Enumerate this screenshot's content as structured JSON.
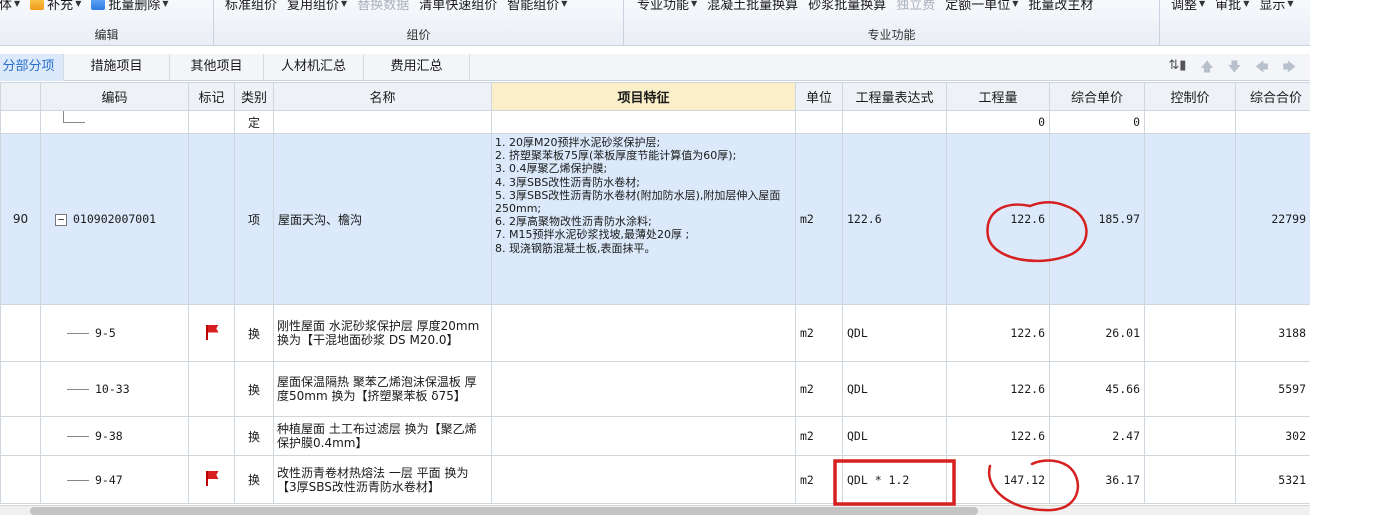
{
  "ribbon": {
    "groups": [
      {
        "label": "编辑",
        "items": [
          {
            "text": "体",
            "caret": true
          },
          {
            "text": "补充",
            "caret": true,
            "icon": "yellow"
          },
          {
            "text": "批量删除",
            "caret": true,
            "icon": "blue"
          }
        ]
      },
      {
        "label": "组价",
        "items": [
          {
            "text": "标准组价"
          },
          {
            "text": "复用组价",
            "caret": true
          },
          {
            "text": "替换数据",
            "disabled": true
          },
          {
            "text": "清单快速组价"
          },
          {
            "text": "智能组价",
            "caret": true
          }
        ]
      },
      {
        "label": "专业功能",
        "items": [
          {
            "text": "专业功能",
            "caret": true
          },
          {
            "text": "混凝土批量换算"
          },
          {
            "text": "砂浆批量换算"
          },
          {
            "text": "独立费",
            "disabled": true
          },
          {
            "text": "定额一单位",
            "caret": true
          },
          {
            "text": "批量改主材"
          }
        ]
      },
      {
        "label": "",
        "items": [
          {
            "text": "调整",
            "caret": true
          },
          {
            "text": "审批",
            "caret": true
          },
          {
            "text": "显示",
            "caret": true
          }
        ]
      }
    ]
  },
  "tabs": [
    "分部分项",
    "措施项目",
    "其他项目",
    "人材机汇总",
    "费用汇总"
  ],
  "tab_tools": [
    "⇅▮",
    "🡅",
    "🡇",
    "🡄",
    "🡆"
  ],
  "columns": [
    "",
    "编码",
    "标记",
    "类别",
    "名称",
    "项目特征",
    "单位",
    "工程量表达式",
    "工程量",
    "综合单价",
    "控制价",
    "综合合价"
  ],
  "rows": [
    {
      "no": "",
      "code": "",
      "mark": false,
      "type": "定",
      "name": "",
      "feature": [],
      "unit": "",
      "expr": "",
      "qty": "0",
      "price": "0",
      "ctrl": "",
      "total": ""
    },
    {
      "no": "90",
      "code": "010902007001",
      "mark": false,
      "type": "项",
      "name": "屋面天沟、檐沟",
      "feature": [
        "1. 20厚M20预拌水泥砂浆保护层;",
        "2. 挤塑聚苯板75厚(苯板厚度节能计算值为60厚);",
        "3. 0.4厚聚乙烯保护膜;",
        "4. 3厚SBS改性沥青防水卷材;",
        "5. 3厚SBS改性沥青防水卷材(附加防水层),附加层伸入屋面250mm;",
        "6. 2厚高聚物改性沥青防水涂料;",
        "7. M15预拌水泥砂浆找坡,最薄处20厚 ;",
        "8. 现浇钢筋混凝土板,表面抹平。"
      ],
      "unit": "m2",
      "expr": "122.6",
      "qty": "122.6",
      "price": "185.97",
      "ctrl": "",
      "total": "22799"
    },
    {
      "no": "",
      "code": "9-5",
      "mark": true,
      "type": "换",
      "name": "刚性屋面 水泥砂浆保护层 厚度20mm  换为【干混地面砂浆 DS M20.0】",
      "feature": [],
      "unit": "m2",
      "expr": "QDL",
      "qty": "122.6",
      "price": "26.01",
      "ctrl": "",
      "total": "3188"
    },
    {
      "no": "",
      "code": "10-33",
      "mark": false,
      "type": "换",
      "name": "屋面保温隔热 聚苯乙烯泡沫保温板 厚度50mm  换为【挤塑聚苯板 δ75】",
      "feature": [],
      "unit": "m2",
      "expr": "QDL",
      "qty": "122.6",
      "price": "45.66",
      "ctrl": "",
      "total": "5597"
    },
    {
      "no": "",
      "code": "9-38",
      "mark": false,
      "type": "换",
      "name": "种植屋面 土工布过滤层  换为【聚乙烯保护膜0.4mm】",
      "feature": [],
      "unit": "m2",
      "expr": "QDL",
      "qty": "122.6",
      "price": "2.47",
      "ctrl": "",
      "total": "302"
    },
    {
      "no": "",
      "code": "9-47",
      "mark": true,
      "type": "换",
      "name": "改性沥青卷材热熔法 一层 平面  换为【3厚SBS改性沥青防水卷材】",
      "feature": [],
      "unit": "m2",
      "expr": "QDL * 1.2",
      "qty": "147.12",
      "price": "36.17",
      "ctrl": "",
      "total": "5321"
    }
  ],
  "colors": {
    "selected_row": "#dbe9fb",
    "header_highlight": "#fbefc9",
    "annotation_red": "#d62020",
    "flag_red": "#d81e1e"
  }
}
